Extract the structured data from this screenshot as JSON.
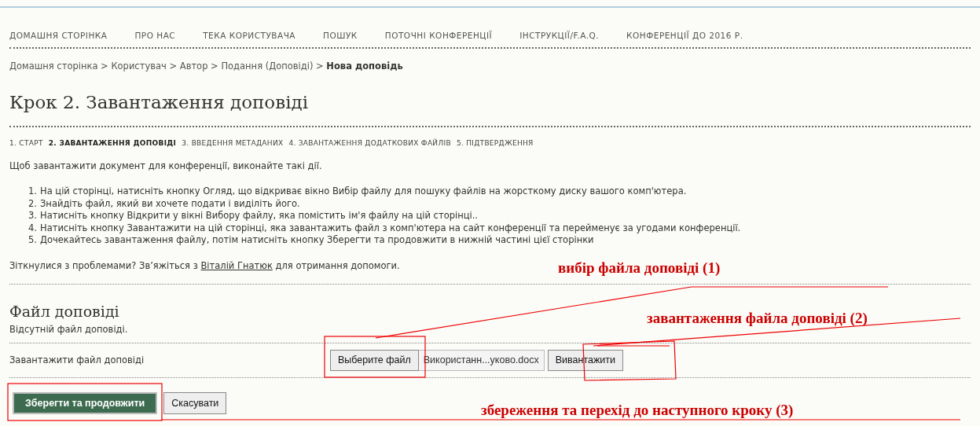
{
  "nav": [
    {
      "label": "ДОМАШНЯ СТОРІНКА"
    },
    {
      "label": "ПРО НАС"
    },
    {
      "label": "ТЕКА КОРИСТУВАЧА"
    },
    {
      "label": "ПОШУК"
    },
    {
      "label": "ПОТОЧНІ КОНФЕРЕНЦІЇ"
    },
    {
      "label": "ІНСТРУКЦІЇ/F.A.Q."
    },
    {
      "label": "КОНФЕРЕНЦІЇ ДО 2016 Р."
    }
  ],
  "breadcrumb": [
    {
      "label": "Домашня сторінка",
      "current": false
    },
    {
      "label": "Користувач",
      "current": false
    },
    {
      "label": "Автор",
      "current": false
    },
    {
      "label": "Подання (Доповіді)",
      "current": false
    },
    {
      "label": "Нова доповідь",
      "current": true
    }
  ],
  "breadcrumb_separator": ">",
  "title": "Крок 2. Завантаження доповіді",
  "steps": [
    {
      "label": "1. СТАРТ",
      "selected": false
    },
    {
      "label": "2. ЗАВАНТАЖЕННЯ ДОПОВІДІ",
      "selected": true
    },
    {
      "label": "3. ВВЕДЕННЯ МЕТАДАНИХ",
      "selected": false
    },
    {
      "label": "4. ЗАВАНТАЖЕННЯ ДОДАТКОВИХ ФАЙЛІВ",
      "selected": false
    },
    {
      "label": "5. ПІДТВЕРДЖЕННЯ",
      "selected": false
    }
  ],
  "intro": "Щоб завантажити документ для конференції, виконайте такі дії.",
  "instructions": [
    {
      "marker": "1.",
      "text": "На цій сторінці, натисніть кнопку Огляд, що відкриває вікно Вибір файлу для пошуку файлів на жорсткому диску вашого комп'ютера."
    },
    {
      "marker": "2.",
      "text": "Знайдіть файл, який ви хочете подати і виділіть його."
    },
    {
      "marker": "3.",
      "text": "Натисніть кнопку Відкрити у вікні Вибору файлу, яка помістить ім'я файлу на цій сторінці.."
    },
    {
      "marker": "4.",
      "text": "Натисніть кнопку Завантажити на цій сторінці, яка завантажить файл з комп'ютера на сайт конференції та перейменує за угодами конференції."
    },
    {
      "marker": "5.",
      "text": "Дочекайтесь завантаження файлу, потім натисніть кнопку Зберегти та продовжити в нижній частині цієї сторінки"
    }
  ],
  "help": {
    "before": "Зіткнулися з проблемами? Зв’яжіться з ",
    "link": "Віталій Гнатюк",
    "after": " для отримання допомоги."
  },
  "section": {
    "heading": "Файл доповіді",
    "note": "Відсутній файл доповіді.",
    "upload_label": "Завантажити файл доповіді",
    "choose_button": "Выберите файл",
    "file_name": "Використанн...уково.docx",
    "upload_button": "Вивантажити"
  },
  "buttons": [
    {
      "label": "Зберегти та продовжити",
      "kind": "primary"
    },
    {
      "label": "Скасувати",
      "kind": "secondary"
    }
  ],
  "annotations": [
    {
      "text": "вибір файла доповіді (1)"
    },
    {
      "text": "завантаження файла доповіді (2)"
    },
    {
      "text": "збереження та перехід до наступного кроку (3)"
    }
  ]
}
